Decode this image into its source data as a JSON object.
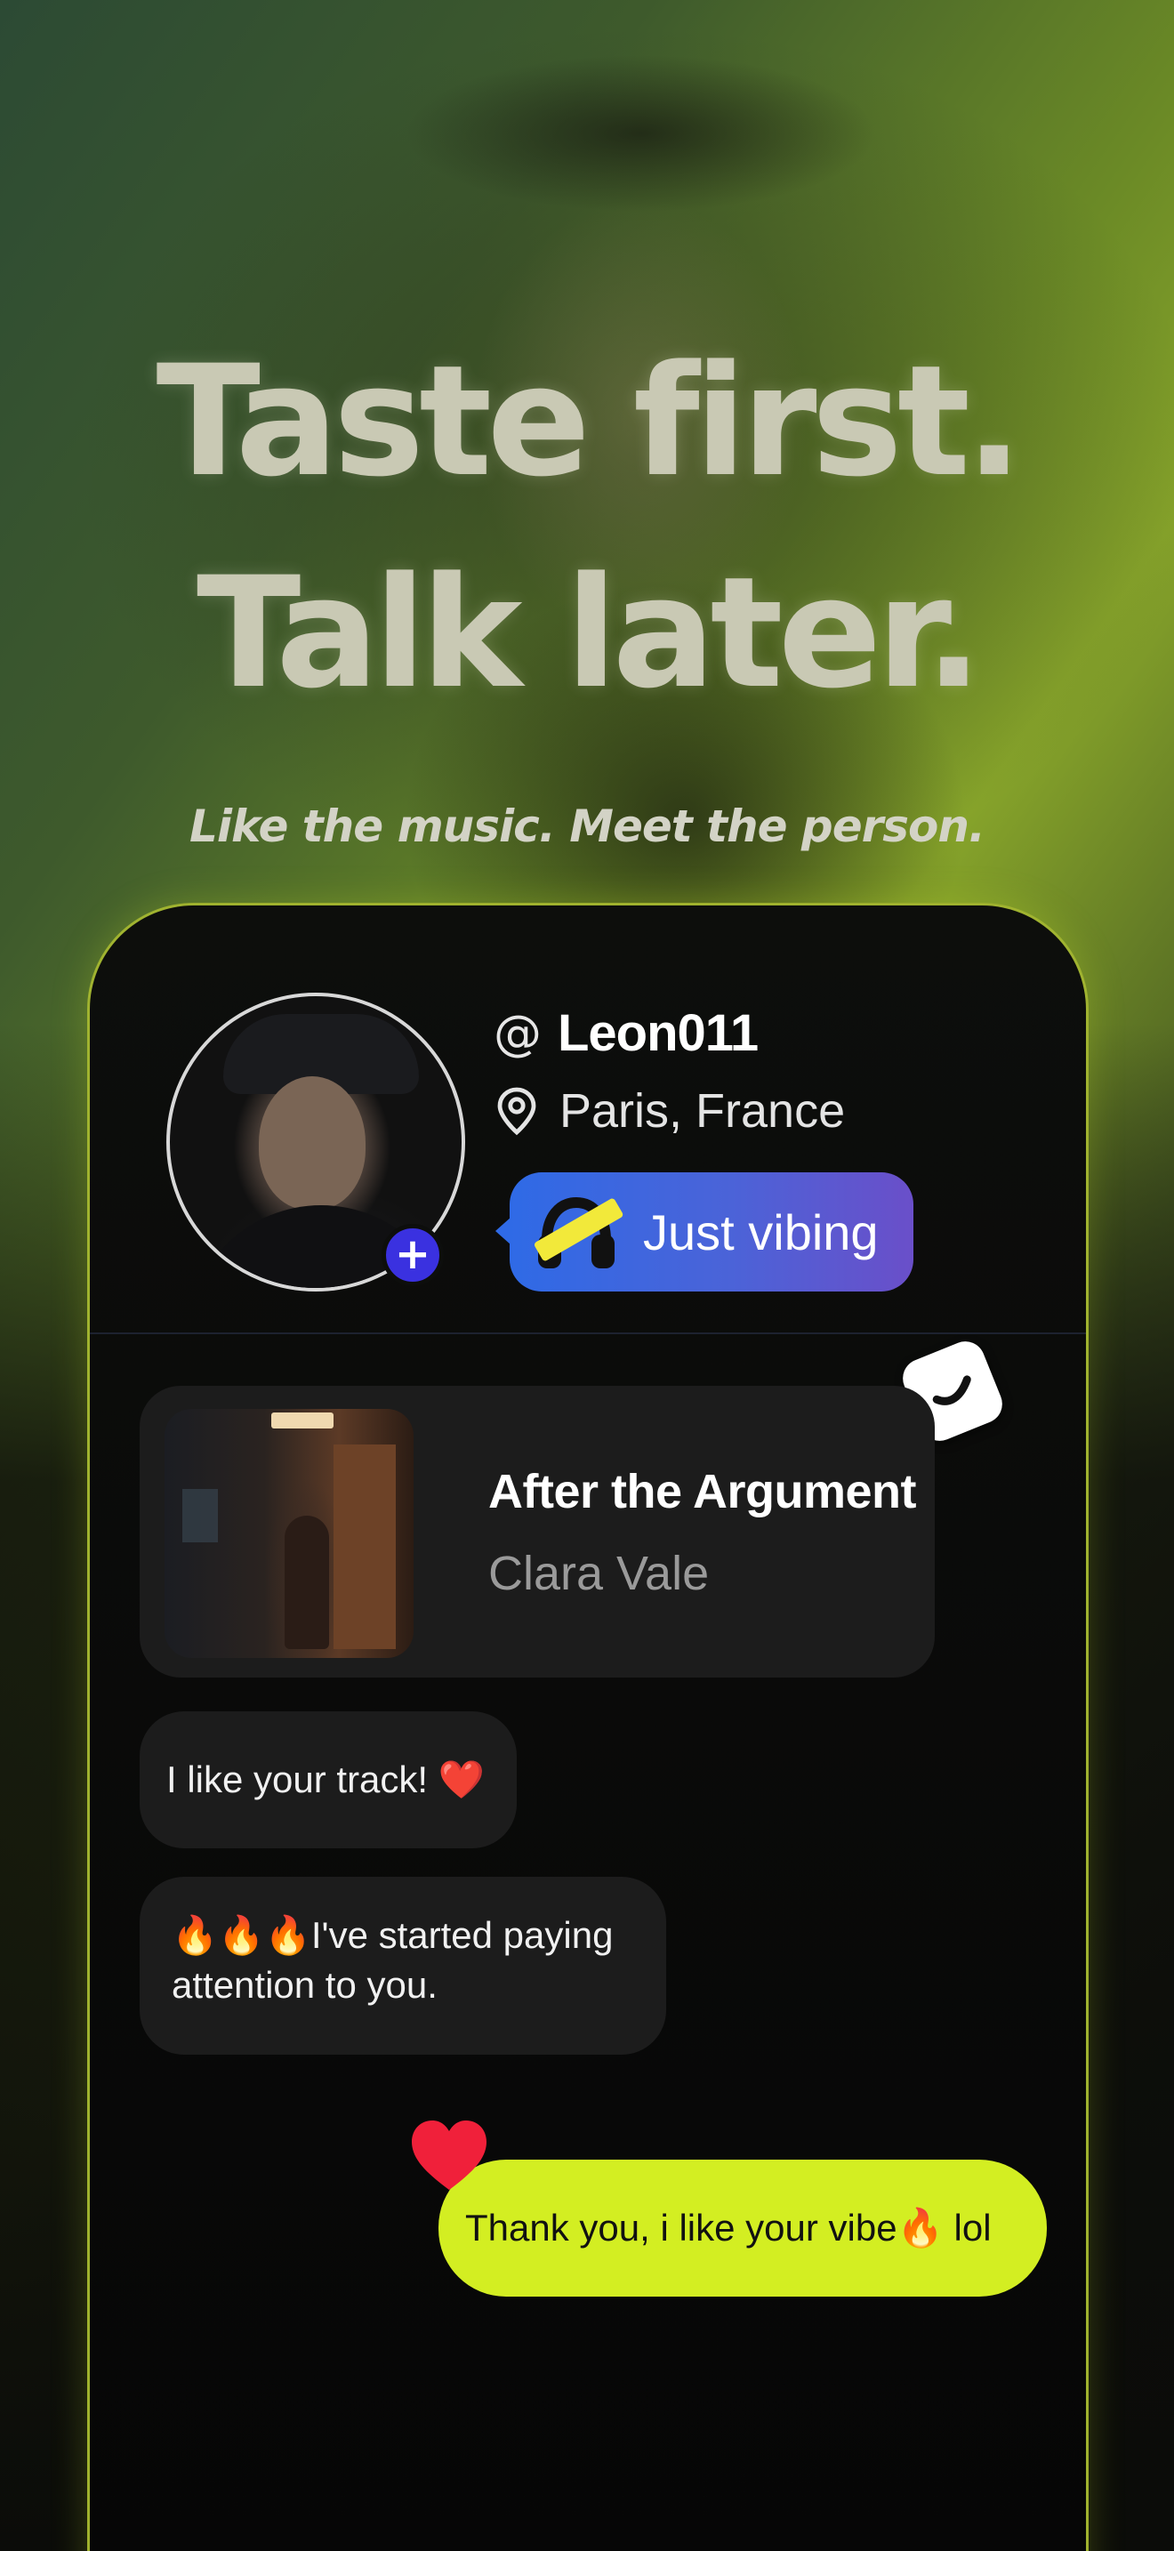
{
  "headline": {
    "line1": "Taste first.",
    "line2": "Talk later."
  },
  "subtitle": "Like the music. Meet the person.",
  "profile": {
    "at_symbol": "@",
    "username": "Leon011",
    "location": "Paris, France",
    "status": "Just vibing"
  },
  "track": {
    "title": "After the Argument",
    "artist": "Clara Vale"
  },
  "messages": [
    {
      "text": "I like your track! ❤️",
      "side": "left"
    },
    {
      "text": "🔥🔥🔥I've started paying attention to you.",
      "side": "left"
    },
    {
      "text": "Thank you,  i like your vibe🔥 lol",
      "side": "right",
      "reaction": "heart"
    }
  ],
  "colors": {
    "accent_green": "#d3ee22",
    "status_blue": "#2f6ae6",
    "status_purple": "#6a4fc9",
    "add_badge": "#3a31e0",
    "heart": "#f0203a"
  },
  "icons": [
    "plus-icon",
    "location-pin-icon",
    "headphones-icon",
    "checkmark-icon",
    "heart-icon"
  ]
}
